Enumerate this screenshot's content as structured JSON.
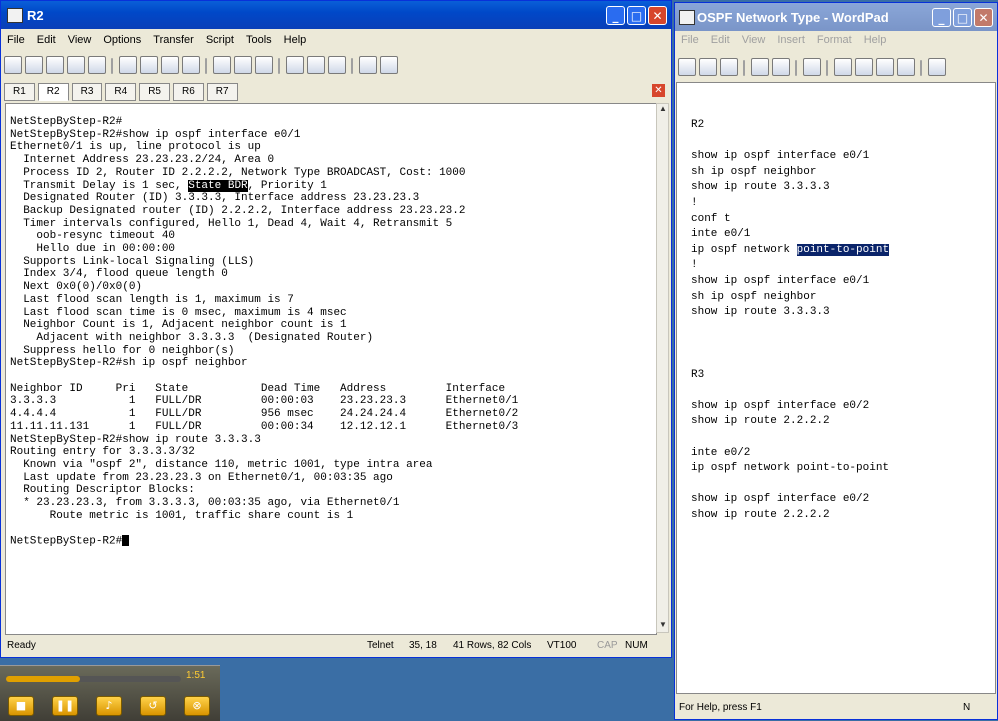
{
  "terminal_window": {
    "title": "R2",
    "controls": {
      "minimize": "_",
      "maximize": "□",
      "close": "✕"
    },
    "menu": [
      "File",
      "Edit",
      "View",
      "Options",
      "Transfer",
      "Script",
      "Tools",
      "Help"
    ],
    "tabs": [
      "R1",
      "R2",
      "R3",
      "R4",
      "R5",
      "R6",
      "R7"
    ],
    "active_tab": "R2",
    "lines": [
      "NetStepByStep-R2#",
      "NetStepByStep-R2#show ip ospf interface e0/1",
      "Ethernet0/1 is up, line protocol is up",
      "  Internet Address 23.23.23.2/24, Area 0",
      "  Process ID 2, Router ID 2.2.2.2, Network Type BROADCAST, Cost: 1000",
      "  Transmit Delay is 1 sec, |State BDR|, Priority 1",
      "  Designated Router (ID) 3.3.3.3, Interface address 23.23.23.3",
      "  Backup Designated router (ID) 2.2.2.2, Interface address 23.23.23.2",
      "  Timer intervals configured, Hello 1, Dead 4, Wait 4, Retransmit 5",
      "    oob-resync timeout 40",
      "    Hello due in 00:00:00",
      "  Supports Link-local Signaling (LLS)",
      "  Index 3/4, flood queue length 0",
      "  Next 0x0(0)/0x0(0)",
      "  Last flood scan length is 1, maximum is 7",
      "  Last flood scan time is 0 msec, maximum is 4 msec",
      "  Neighbor Count is 1, Adjacent neighbor count is 1",
      "    Adjacent with neighbor 3.3.3.3  (Designated Router)",
      "  Suppress hello for 0 neighbor(s)",
      "NetStepByStep-R2#sh ip ospf neighbor",
      "",
      "Neighbor ID     Pri   State           Dead Time   Address         Interface",
      "3.3.3.3           1   FULL/DR         00:00:03    23.23.23.3      Ethernet0/1",
      "4.4.4.4           1   FULL/DR         956 msec    24.24.24.4      Ethernet0/2",
      "11.11.11.131      1   FULL/DR         00:00:34    12.12.12.1      Ethernet0/3",
      "NetStepByStep-R2#show ip route 3.3.3.3",
      "Routing entry for 3.3.3.3/32",
      "  Known via \"ospf 2\", distance 110, metric 1001, type intra area",
      "  Last update from 23.23.23.3 on Ethernet0/1, 00:03:35 ago",
      "  Routing Descriptor Blocks:",
      "  * 23.23.23.3, from 3.3.3.3, 00:03:35 ago, via Ethernet0/1",
      "      Route metric is 1001, traffic share count is 1",
      "",
      "NetStepByStep-R2#"
    ],
    "status": {
      "ready": "Ready",
      "protocol": "Telnet",
      "position": "35, 18",
      "size": "41 Rows, 82 Cols",
      "emulation": "VT100",
      "cap": "CAP",
      "num": "NUM"
    }
  },
  "wordpad_window": {
    "title": "OSPF Network Type - WordPad",
    "controls": {
      "minimize": "_",
      "maximize": "□",
      "close": "✕"
    },
    "menu": [
      "File",
      "Edit",
      "View",
      "Insert",
      "Format",
      "Help"
    ],
    "document_lines": [
      "R2",
      "",
      "show ip ospf interface e0/1",
      "sh ip ospf neighbor",
      "show ip route 3.3.3.3",
      "!",
      "conf t",
      "inte e0/1",
      "ip ospf network |point-to-point|",
      "!",
      "show ip ospf interface e0/1",
      "sh ip ospf neighbor",
      "show ip route 3.3.3.3",
      "",
      "",
      "",
      "R3",
      "",
      "show ip ospf interface e0/2",
      "show ip route 2.2.2.2",
      "",
      "inte e0/2",
      "ip ospf network point-to-point",
      "",
      "show ip ospf interface e0/2",
      "show ip route 2.2.2.2"
    ],
    "status": {
      "help": "For Help, press F1",
      "num": "N"
    }
  },
  "player": {
    "time": "1:51",
    "progress": 0.42
  }
}
